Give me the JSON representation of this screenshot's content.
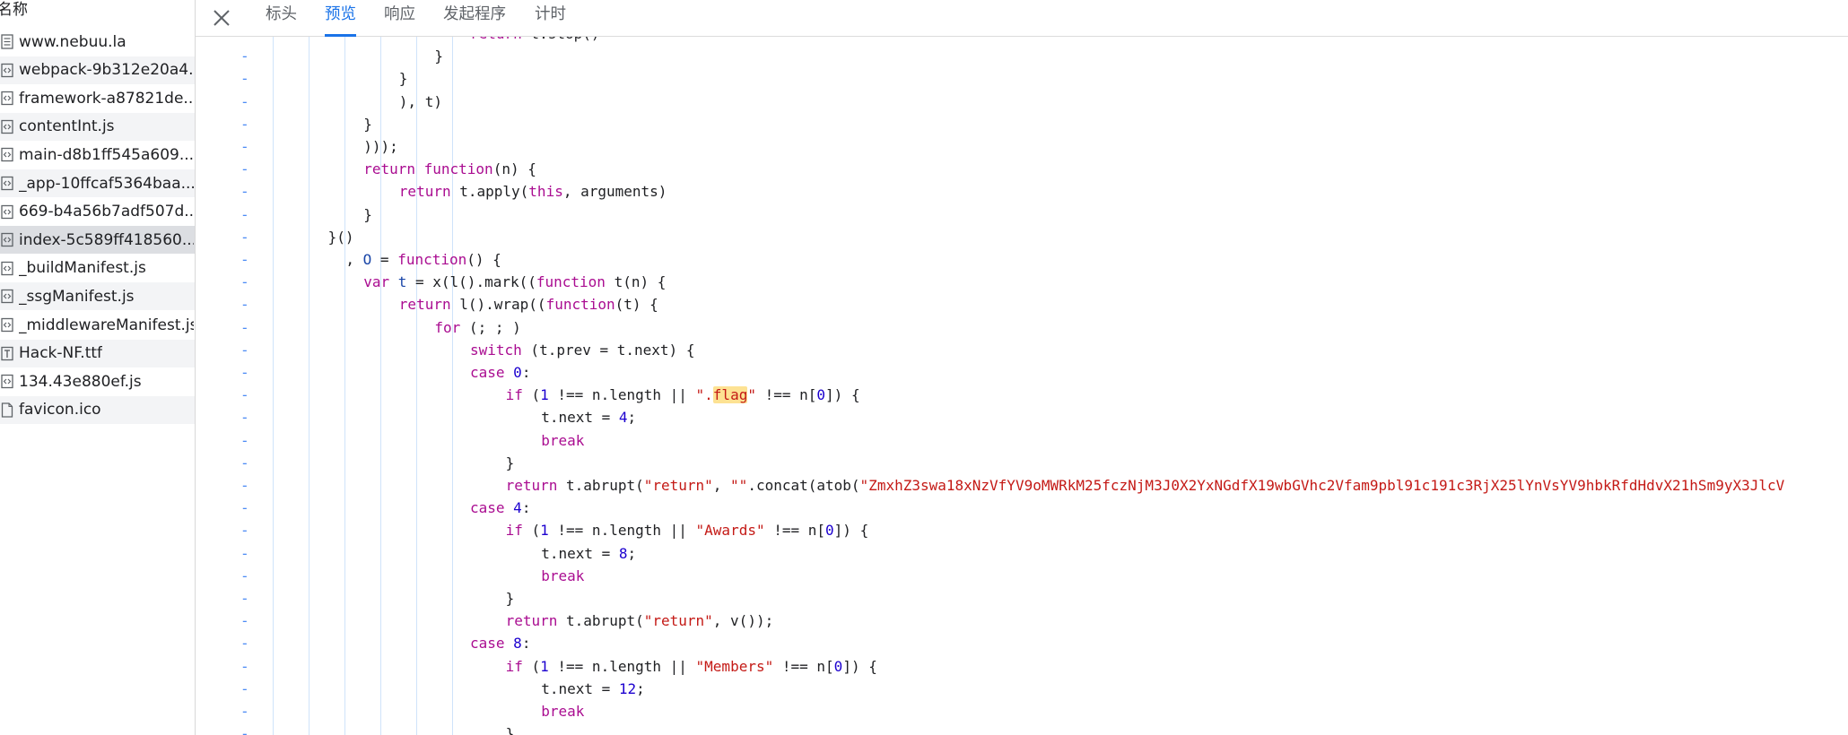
{
  "list": {
    "header": "名称",
    "items": [
      {
        "name": "www.nebuu.la",
        "icon": "document-icon"
      },
      {
        "name": "webpack-9b312e20a4...",
        "icon": "script-icon"
      },
      {
        "name": "framework-a87821de...",
        "icon": "script-icon"
      },
      {
        "name": "contentInt.js",
        "icon": "script-icon"
      },
      {
        "name": "main-d8b1ff545a609...",
        "icon": "script-icon"
      },
      {
        "name": "_app-10ffcaf5364baa...",
        "icon": "script-icon"
      },
      {
        "name": "669-b4a56b7adf507d...",
        "icon": "script-icon"
      },
      {
        "name": "index-5c589ff418560...",
        "icon": "script-icon",
        "selected": true
      },
      {
        "name": "_buildManifest.js",
        "icon": "script-icon"
      },
      {
        "name": "_ssgManifest.js",
        "icon": "script-icon"
      },
      {
        "name": "_middlewareManifest.js",
        "icon": "script-icon"
      },
      {
        "name": "Hack-NF.ttf",
        "icon": "font-icon"
      },
      {
        "name": "134.43e880ef.js",
        "icon": "script-icon"
      },
      {
        "name": "favicon.ico",
        "icon": "file-icon"
      }
    ]
  },
  "tabs": {
    "headers": "标头",
    "preview": "预览",
    "response": "响应",
    "initiator": "发起程序",
    "timing": "计时",
    "active": "preview"
  },
  "colors": {
    "accent": "#1a73e8",
    "keyword": "#aa0d91",
    "string": "#c41a16",
    "number": "#1c00cf",
    "variable": "#1a46a8",
    "search_highlight": "#fde293"
  },
  "gutter_marker": "-",
  "code_lines": [
    {
      "indent": 10,
      "tokens": [
        [
          "kw",
          "return"
        ],
        [
          "t",
          " t.stop()"
        ]
      ]
    },
    {
      "indent": 8,
      "tokens": [
        [
          "t",
          "}"
        ]
      ]
    },
    {
      "indent": 6,
      "tokens": [
        [
          "t",
          "}"
        ]
      ]
    },
    {
      "indent": 6,
      "tokens": [
        [
          "t",
          "), t)"
        ]
      ]
    },
    {
      "indent": 4,
      "tokens": [
        [
          "t",
          "}"
        ]
      ]
    },
    {
      "indent": 4,
      "tokens": [
        [
          "t",
          ")));"
        ]
      ]
    },
    {
      "indent": 4,
      "tokens": [
        [
          "kw",
          "return "
        ],
        [
          "kw",
          "function"
        ],
        [
          "t",
          "(n) {"
        ]
      ]
    },
    {
      "indent": 6,
      "tokens": [
        [
          "kw",
          "return"
        ],
        [
          "t",
          " t.apply("
        ],
        [
          "kw",
          "this"
        ],
        [
          "t",
          ", arguments)"
        ]
      ]
    },
    {
      "indent": 4,
      "tokens": [
        [
          "t",
          "}"
        ]
      ]
    },
    {
      "indent": 2,
      "tokens": [
        [
          "t",
          "}()"
        ]
      ]
    },
    {
      "indent": 3,
      "tokens": [
        [
          "t",
          ", "
        ],
        [
          "var",
          "O"
        ],
        [
          "t",
          " = "
        ],
        [
          "kw",
          "function"
        ],
        [
          "t",
          "() {"
        ]
      ]
    },
    {
      "indent": 4,
      "tokens": [
        [
          "kw",
          "var"
        ],
        [
          "t",
          " "
        ],
        [
          "var",
          "t"
        ],
        [
          "t",
          " = x(l().mark(("
        ],
        [
          "kw",
          "function"
        ],
        [
          "t",
          " t(n) {"
        ]
      ]
    },
    {
      "indent": 6,
      "tokens": [
        [
          "kw",
          "return"
        ],
        [
          "t",
          " l().wrap(("
        ],
        [
          "kw",
          "function"
        ],
        [
          "t",
          "(t) {"
        ]
      ]
    },
    {
      "indent": 8,
      "tokens": [
        [
          "kw",
          "for"
        ],
        [
          "t",
          " (; ; )"
        ]
      ]
    },
    {
      "indent": 10,
      "tokens": [
        [
          "kw",
          "switch"
        ],
        [
          "t",
          " (t.prev = t.next) {"
        ]
      ]
    },
    {
      "indent": 10,
      "tokens": [
        [
          "kw",
          "case "
        ],
        [
          "num",
          "0"
        ],
        [
          "t",
          ":"
        ]
      ]
    },
    {
      "indent": 12,
      "tokens": [
        [
          "kw",
          "if"
        ],
        [
          "t",
          " ("
        ],
        [
          "num",
          "1"
        ],
        [
          "t",
          " !== n.length || "
        ],
        [
          "str",
          "\"."
        ],
        [
          "hl",
          "flag"
        ],
        [
          "str",
          "\""
        ],
        [
          "t",
          " !== n["
        ],
        [
          "num",
          "0"
        ],
        [
          "t",
          "]) {"
        ]
      ]
    },
    {
      "indent": 14,
      "tokens": [
        [
          "t",
          "t.next = "
        ],
        [
          "num",
          "4"
        ],
        [
          "t",
          ";"
        ]
      ]
    },
    {
      "indent": 14,
      "tokens": [
        [
          "kw",
          "break"
        ]
      ]
    },
    {
      "indent": 12,
      "tokens": [
        [
          "t",
          "}"
        ]
      ]
    },
    {
      "indent": 12,
      "tokens": [
        [
          "kw",
          "return"
        ],
        [
          "t",
          " t.abrupt("
        ],
        [
          "str",
          "\"return\""
        ],
        [
          "t",
          ", "
        ],
        [
          "str",
          "\"\""
        ],
        [
          "t",
          ".concat(atob("
        ],
        [
          "str",
          "\"ZmxhZ3swa18xNzVfYV9oMWRkM25fczNjM3J0X2YxNGdfX19wbGVhc2Vfam9pbl91c191c3RjX25lYnVsYV9hbkRfdHdvX21hSm9yX3JlcV"
        ]
      ]
    },
    {
      "indent": 10,
      "tokens": [
        [
          "kw",
          "case "
        ],
        [
          "num",
          "4"
        ],
        [
          "t",
          ":"
        ]
      ]
    },
    {
      "indent": 12,
      "tokens": [
        [
          "kw",
          "if"
        ],
        [
          "t",
          " ("
        ],
        [
          "num",
          "1"
        ],
        [
          "t",
          " !== n.length || "
        ],
        [
          "str",
          "\"Awards\""
        ],
        [
          "t",
          " !== n["
        ],
        [
          "num",
          "0"
        ],
        [
          "t",
          "]) {"
        ]
      ]
    },
    {
      "indent": 14,
      "tokens": [
        [
          "t",
          "t.next = "
        ],
        [
          "num",
          "8"
        ],
        [
          "t",
          ";"
        ]
      ]
    },
    {
      "indent": 14,
      "tokens": [
        [
          "kw",
          "break"
        ]
      ]
    },
    {
      "indent": 12,
      "tokens": [
        [
          "t",
          "}"
        ]
      ]
    },
    {
      "indent": 12,
      "tokens": [
        [
          "kw",
          "return"
        ],
        [
          "t",
          " t.abrupt("
        ],
        [
          "str",
          "\"return\""
        ],
        [
          "t",
          ", v());"
        ]
      ]
    },
    {
      "indent": 10,
      "tokens": [
        [
          "kw",
          "case "
        ],
        [
          "num",
          "8"
        ],
        [
          "t",
          ":"
        ]
      ]
    },
    {
      "indent": 12,
      "tokens": [
        [
          "kw",
          "if"
        ],
        [
          "t",
          " ("
        ],
        [
          "num",
          "1"
        ],
        [
          "t",
          " !== n.length || "
        ],
        [
          "str",
          "\"Members\""
        ],
        [
          "t",
          " !== n["
        ],
        [
          "num",
          "0"
        ],
        [
          "t",
          "]) {"
        ]
      ]
    },
    {
      "indent": 14,
      "tokens": [
        [
          "t",
          "t.next = "
        ],
        [
          "num",
          "12"
        ],
        [
          "t",
          ";"
        ]
      ]
    },
    {
      "indent": 14,
      "tokens": [
        [
          "kw",
          "break"
        ]
      ]
    },
    {
      "indent": 12,
      "tokens": [
        [
          "t",
          "}"
        ]
      ]
    }
  ]
}
